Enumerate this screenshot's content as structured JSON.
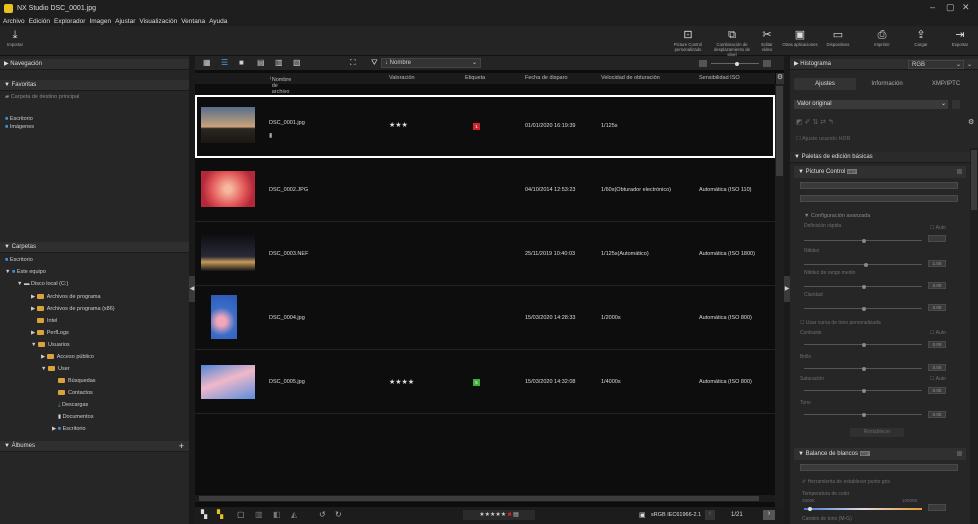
{
  "app": {
    "title": "NX Studio   DSC_0001.jpg"
  },
  "menu": [
    "Archivo",
    "Edición",
    "Explorador",
    "Imagen",
    "Ajustar",
    "Visualización",
    "Ventana",
    "Ayuda"
  ],
  "toolbar": {
    "import": "Importar",
    "picture_control": "Picture Control personalizado",
    "combine": "Combinación de desplazamiento de píxel",
    "edit_video": "Editar vídeo",
    "other_apps": "Otras aplicaciones",
    "devices": "Dispositivos",
    "print": "Imprimir",
    "upload": "Cargar",
    "export": "Exportar"
  },
  "left": {
    "nav": "Navegación",
    "favorites": "Favoritas",
    "fav_items": [
      "Carpeta de destino principal",
      "Escritorio",
      "Imágenes"
    ],
    "folders": "Carpetas",
    "tree": [
      "Escritorio",
      "Este equipo",
      "Disco local (C:)",
      "Archivos de programa",
      "Archivos de programa (x86)",
      "Intel",
      "PerfLogs",
      "Usuarios",
      "Acceso público",
      "User",
      "Búsquedas",
      "Contactos",
      "Descargas",
      "Documentos",
      "Escritorio"
    ],
    "albums": "Álbumes"
  },
  "center": {
    "sort": "Nombre",
    "columns": [
      "Nombre de archivo",
      "Valoración",
      "Etiqueta",
      "Fecha de disparo",
      "Velocidad de obturación",
      "Sensibilidad ISO"
    ],
    "rows": [
      {
        "name": "DSC_0001.jpg",
        "rating": "★★★",
        "label": "1",
        "label_color": "#d0232a",
        "date": "01/01/2020 16:19:39",
        "shutter": "1/125s",
        "iso": ""
      },
      {
        "name": "DSC_0002.JPG",
        "rating": "",
        "label": "",
        "label_color": "",
        "date": "04/10/2014 12:53:23",
        "shutter": "1/60s(Obturador electrónico)",
        "iso": "Automática (ISO 110)"
      },
      {
        "name": "DSC_0003.NEF",
        "rating": "",
        "label": "",
        "label_color": "",
        "date": "25/11/2019 10:40:03",
        "shutter": "1/125s(Automático)",
        "iso": "Automática (ISO 1800)"
      },
      {
        "name": "DSC_0004.jpg",
        "rating": "",
        "label": "",
        "label_color": "",
        "date": "15/03/2020 14:28:33",
        "shutter": "1/2000s",
        "iso": "Automática (ISO 800)"
      },
      {
        "name": "DSC_0005.jpg",
        "rating": "★★★★",
        "label": "5",
        "label_color": "#3fae3f",
        "date": "15/03/2020 14:32:08",
        "shutter": "1/4000s",
        "iso": "Automática (ISO 800)"
      }
    ],
    "status_profile": "sRGB IEC61966-2.1",
    "status_count": "1/21"
  },
  "right": {
    "histogram": "Histograma",
    "channel": "RGB",
    "tabs": [
      "Ajustes",
      "Información",
      "XMP/IPTC"
    ],
    "preset": "Valor original",
    "hdr": "Ajuste usando HDR",
    "palettes": "Paletas de edición básicas",
    "picture_control": "Picture Control",
    "advanced": "Configuración avanzada",
    "quick": "Definición rápida",
    "auto": "Auto",
    "sharp": "Nitidez",
    "midsharp": "Nitidez de rango medio",
    "clarity": "Claridad",
    "curve": "Usar curva de tono personalizada",
    "contrast": "Contraste",
    "brightness": "Brillo",
    "saturation": "Saturación",
    "hue": "Tono",
    "reset": "Restablecer",
    "wb": "Balance de blancos",
    "gray": "Herramienta de establecer punto gris",
    "temp": "Temperatura de color",
    "temp_min": "2500K",
    "temp_max": "10000K",
    "tint": "Cambio de tono (M-G)",
    "val_100": "1.00",
    "val_000": "0.00"
  }
}
